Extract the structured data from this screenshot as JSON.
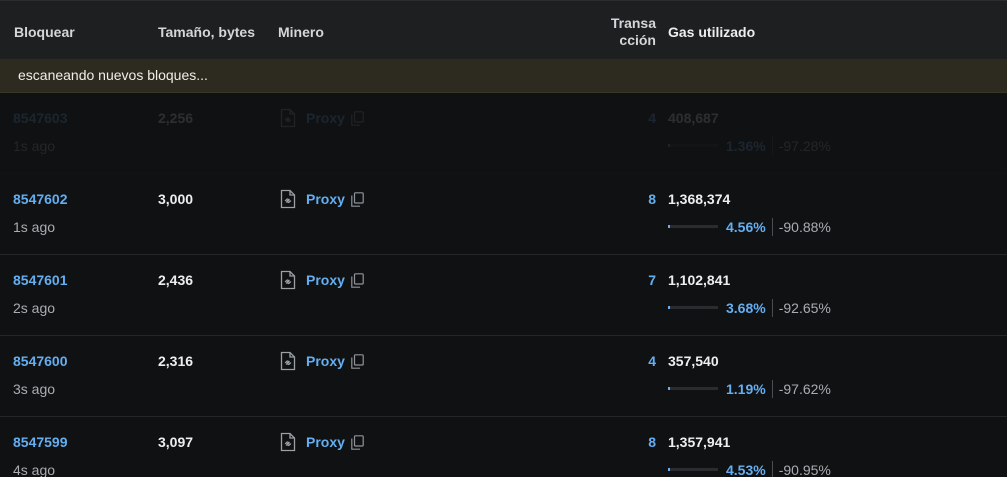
{
  "header": {
    "block": "Bloquear",
    "size": "Tamaño, bytes",
    "miner": "Minero",
    "txn_line1": "Transa",
    "txn_line2": "cción",
    "gas": "Gas utilizado"
  },
  "status_banner": "escaneando nuevos bloques...",
  "rows": [
    {
      "block": "8547603",
      "age": "1s ago",
      "size": "2,256",
      "miner": "Proxy",
      "txns": "4",
      "gas_used": "408,687",
      "gas_pct": "1.36%",
      "gas_delta": "-97.28%",
      "gas_fill": 0.0136
    },
    {
      "block": "8547602",
      "age": "1s ago",
      "size": "3,000",
      "miner": "Proxy",
      "txns": "8",
      "gas_used": "1,368,374",
      "gas_pct": "4.56%",
      "gas_delta": "-90.88%",
      "gas_fill": 0.0456
    },
    {
      "block": "8547601",
      "age": "2s ago",
      "size": "2,436",
      "miner": "Proxy",
      "txns": "7",
      "gas_used": "1,102,841",
      "gas_pct": "3.68%",
      "gas_delta": "-92.65%",
      "gas_fill": 0.0368
    },
    {
      "block": "8547600",
      "age": "3s ago",
      "size": "2,316",
      "miner": "Proxy",
      "txns": "4",
      "gas_used": "357,540",
      "gas_pct": "1.19%",
      "gas_delta": "-97.62%",
      "gas_fill": 0.0119
    },
    {
      "block": "8547599",
      "age": "4s ago",
      "size": "3,097",
      "miner": "Proxy",
      "txns": "8",
      "gas_used": "1,357,941",
      "gas_pct": "4.53%",
      "gas_delta": "-90.95%",
      "gas_fill": 0.0453
    }
  ],
  "icons": {
    "miner_contract": "contract-file-icon",
    "copy": "copy-icon"
  },
  "colors": {
    "link": "#64aef2",
    "background": "#101112",
    "header": "#1d1f21",
    "banner": "#2d2a20"
  }
}
